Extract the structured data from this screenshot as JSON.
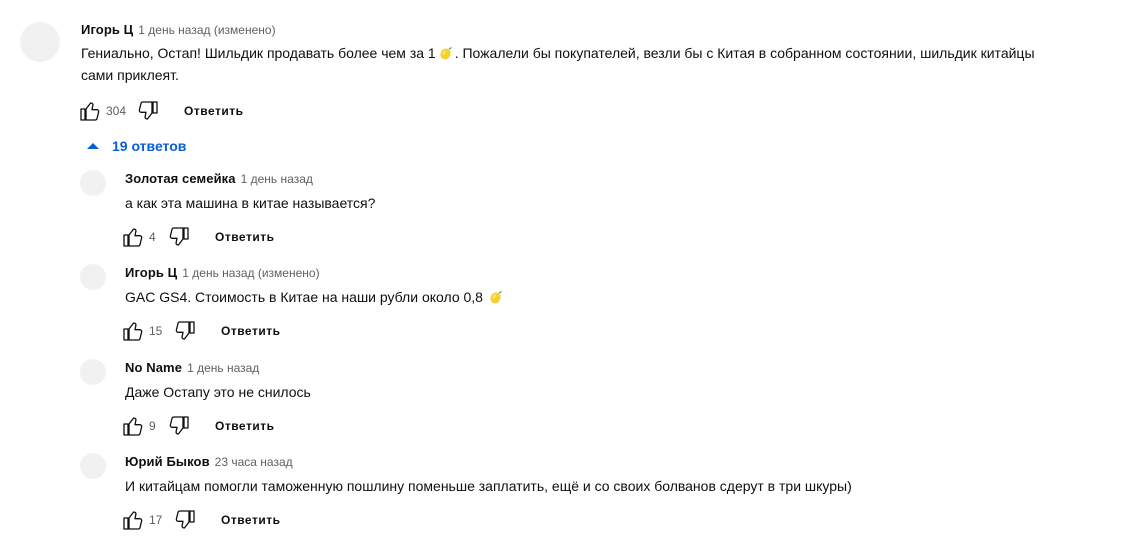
{
  "top_comment": {
    "author": "Игорь Ц",
    "meta": "1 день назад (изменено)",
    "text_part1": "Гениально, Остап! Шильдик продавать более чем за 1",
    "emoji_icon": "lemon-icon",
    "text_part2": ". Пожалели бы покупателей, везли бы с Китая в собранном состоянии, шильдик китайцы",
    "text_line2": "сами приклеят.",
    "likes": "304",
    "reply_label": "Ответить"
  },
  "replies_toggle": {
    "label": "19 ответов",
    "color": "#065fd4"
  },
  "replies": [
    {
      "author": "Золотая семейка",
      "meta": "1 день назад",
      "text": "а как эта машина в китае называется?",
      "likes": "4",
      "reply_label": "Ответить"
    },
    {
      "author": "Игорь Ц",
      "meta": "1 день назад (изменено)",
      "text": "GAC GS4. Стоимость в Китае на наши рубли около 0,8",
      "emoji_icon": "lemon-icon",
      "likes": "15",
      "reply_label": "Ответить"
    },
    {
      "author": "No Name",
      "meta": "1 день назад",
      "text": "Даже Остапу это не снилось",
      "likes": "9",
      "reply_label": "Ответить"
    },
    {
      "author": "Юрий Быков",
      "meta": "23 часа назад",
      "text": "И китайцам помогли таможенную пошлину поменьше заплатить, ещё и со своих болванов сдерут в три шкуры)",
      "likes": "17",
      "reply_label": "Ответить"
    }
  ]
}
